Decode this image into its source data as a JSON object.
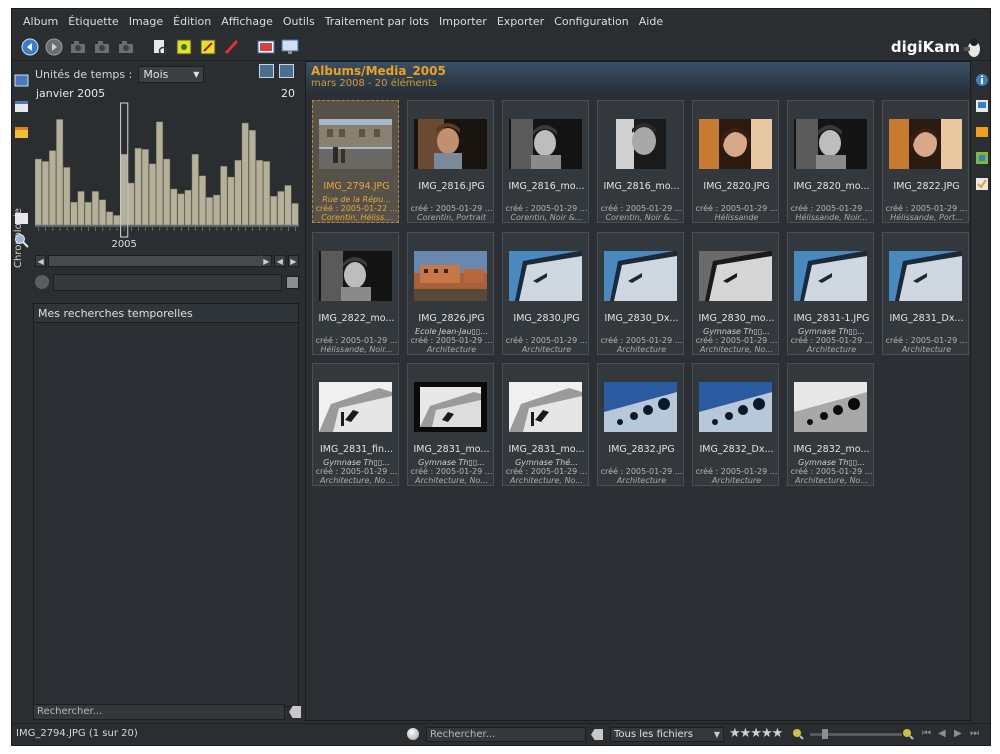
{
  "menu": [
    "Album",
    "Étiquette",
    "Image",
    "Édition",
    "Affichage",
    "Outils",
    "Traitement par lots",
    "Importer",
    "Exporter",
    "Configuration",
    "Aide"
  ],
  "toolbar": {
    "icons": [
      "back-icon",
      "forward-icon",
      "camera-icon",
      "camera2-icon",
      "camera3-icon",
      "open-document-icon",
      "view-icon",
      "edit-icon",
      "paint-icon",
      "slideshow-icon",
      "fullscreen-icon"
    ],
    "logo": "digiKam"
  },
  "sidebar_left": {
    "tab_label": "Chronologie"
  },
  "timeline": {
    "unit_label": "Unités de temps :",
    "unit_value": "Mois",
    "period_label": "janvier 2005",
    "count": "20",
    "year_label": "2005",
    "bars": [
      0.55,
      0.53,
      0.62,
      0.88,
      0.48,
      0.19,
      0.28,
      0.19,
      0.28,
      0.21,
      0.11,
      0.08,
      0.59,
      0.35,
      0.64,
      0.63,
      0.51,
      0.86,
      0.55,
      0.3,
      0.26,
      0.29,
      0.59,
      0.41,
      0.23,
      0.25,
      0.49,
      0.4,
      0.54,
      0.85,
      0.79,
      0.54,
      0.53,
      0.24,
      0.28,
      0.33,
      0.18
    ],
    "selected_bar": 12,
    "saved_searches_title": "Mes recherches temporelles"
  },
  "left_filter": {
    "placeholder": "Rechercher..."
  },
  "album": {
    "title": "Albums/Media_2005",
    "subtitle": "mars 2008 - 20 éléments"
  },
  "thumbnails": [
    {
      "name": "IMG_2794.JPG",
      "l1": "Rue de la Répu...",
      "l2": "créé : 2005-01-22 ...",
      "l3": "Corentin, Héliss...",
      "selected": true,
      "style": "street"
    },
    {
      "name": "IMG_2816.JPG",
      "l1": "",
      "l2": "créé : 2005-01-29 ...",
      "l3": "Corentin, Portrait",
      "selected": false,
      "style": "portrait-warm"
    },
    {
      "name": "IMG_2816_mo...",
      "l1": "",
      "l2": "créé : 2005-01-29 ...",
      "l3": "Corentin, Noir &...",
      "selected": false,
      "style": "portrait-bw"
    },
    {
      "name": "IMG_2816_mo...",
      "l1": "",
      "l2": "créé : 2005-01-29 ...",
      "l3": "Corentin, Noir &...",
      "selected": false,
      "style": "portrait-bw-tall"
    },
    {
      "name": "IMG_2820.JPG",
      "l1": "",
      "l2": "créé : 2005-01-29 ...",
      "l3": "Hélissande",
      "selected": false,
      "style": "portrait-orange"
    },
    {
      "name": "IMG_2820_mo...",
      "l1": "",
      "l2": "créé : 2005-01-29 ...",
      "l3": "Hélissande, Noir...",
      "selected": false,
      "style": "portrait-bw"
    },
    {
      "name": "IMG_2822.JPG",
      "l1": "",
      "l2": "créé : 2005-01-29 ...",
      "l3": "Hélissande, Port...",
      "selected": false,
      "style": "portrait-orange"
    },
    {
      "name": "IMG_2822_mo...",
      "l1": "",
      "l2": "créé : 2005-01-29 ...",
      "l3": "Hélissande, Noir...",
      "selected": false,
      "style": "portrait-bw"
    },
    {
      "name": "IMG_2826.JPG",
      "l1": "Ecole Jean-Jau▯▯...",
      "l2": "créé : 2005-01-29 ...",
      "l3": "Architecture",
      "selected": false,
      "style": "building-sunset"
    },
    {
      "name": "IMG_2830.JPG",
      "l1": "",
      "l2": "créé : 2005-01-29 ...",
      "l3": "Architecture",
      "selected": false,
      "style": "arch-blue"
    },
    {
      "name": "IMG_2830_Dx...",
      "l1": "",
      "l2": "créé : 2005-01-29 ...",
      "l3": "Architecture",
      "selected": false,
      "style": "arch-blue"
    },
    {
      "name": "IMG_2830_mo...",
      "l1": "Gymnase Th▯▯...",
      "l2": "créé : 2005-01-29 ...",
      "l3": "Architecture, No...",
      "selected": false,
      "style": "arch-grey"
    },
    {
      "name": "IMG_2831-1.JPG",
      "l1": "Gymnase Th▯▯...",
      "l2": "créé : 2005-01-29 ...",
      "l3": "Architecture",
      "selected": false,
      "style": "arch-blue"
    },
    {
      "name": "IMG_2831_Dx...",
      "l1": "",
      "l2": "créé : 2005-01-29 ...",
      "l3": "Architecture",
      "selected": false,
      "style": "arch-blue"
    },
    {
      "name": "IMG_2831_fin...",
      "l1": "Gymnase Th▯▯...",
      "l2": "créé : 2005-01-29 ...",
      "l3": "Architecture, No...",
      "selected": false,
      "style": "arch-bw"
    },
    {
      "name": "IMG_2831_mo...",
      "l1": "Gymnase Th▯▯...",
      "l2": "créé : 2005-01-29 ...",
      "l3": "Architecture, No...",
      "selected": false,
      "style": "arch-bw-frame"
    },
    {
      "name": "IMG_2831_mo...",
      "l1": "Gymnase Thé...",
      "l2": "créé : 2005-01-29 ...",
      "l3": "Architecture, No...",
      "selected": false,
      "style": "arch-bw"
    },
    {
      "name": "IMG_2832.JPG",
      "l1": "",
      "l2": "créé : 2005-01-29 ...",
      "l3": "Architecture",
      "selected": false,
      "style": "arch-holes-blue"
    },
    {
      "name": "IMG_2832_Dx...",
      "l1": "",
      "l2": "créé : 2005-01-29 ...",
      "l3": "Architecture",
      "selected": false,
      "style": "arch-holes-blue"
    },
    {
      "name": "IMG_2832_mo...",
      "l1": "Gymnase Th▯▯...",
      "l2": "créé : 2005-01-29 ...",
      "l3": "Architecture, No...",
      "selected": false,
      "style": "arch-holes-bw"
    }
  ],
  "statusbar": {
    "status": "IMG_2794.JPG (1 sur 20)",
    "search_placeholder": "Rechercher...",
    "file_filter": "Tous les fichiers",
    "rating": "★★★★★"
  },
  "colors": {
    "accent": "#f0a020",
    "background": "#2a2e31"
  }
}
